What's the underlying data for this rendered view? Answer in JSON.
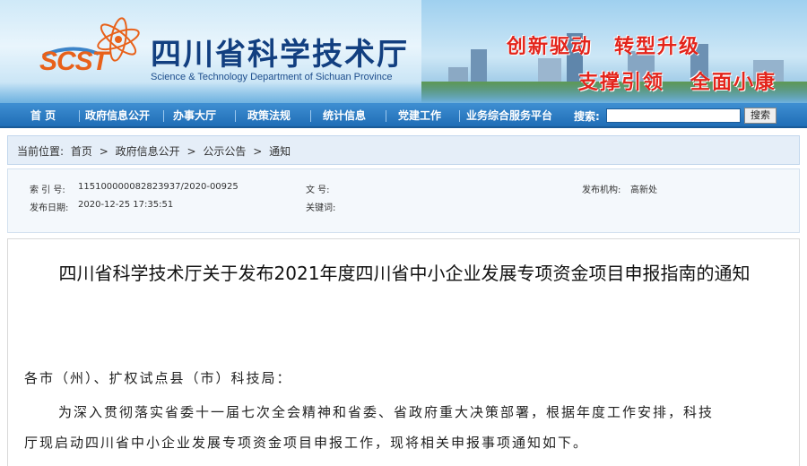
{
  "header": {
    "logo_text": "SCST",
    "site_title": "四川省科学技术厅",
    "site_subtitle": "Science & Technology Department of Sichuan Province",
    "slogans": [
      "创新驱动",
      "转型升级",
      "支撑引领",
      "全面小康"
    ],
    "colors": {
      "title": "#123f80",
      "slogan": "#e3241b",
      "logo": "#e8611a"
    }
  },
  "nav": {
    "items": [
      "首 页",
      "政府信息公开",
      "办事大厅",
      "政策法规",
      "统计信息",
      "党建工作",
      "业务综合服务平台"
    ],
    "search_label": "搜索:",
    "search_value": "",
    "search_button": "搜索"
  },
  "breadcrumb": {
    "label": "当前位置:",
    "items": [
      "首页",
      "政府信息公开",
      "公示公告",
      "通知"
    ],
    "separator": ">"
  },
  "meta": {
    "index_label": "索 引 号:",
    "index_value": "115100000082823937/2020-00925",
    "doc_label": "文 号:",
    "doc_value": "",
    "org_label": "发布机构:",
    "org_value": "高新处",
    "date_label": "发布日期:",
    "date_value": "2020-12-25 17:35:51",
    "keyword_label": "关键词:",
    "keyword_value": ""
  },
  "article": {
    "title": "四川省科学技术厅关于发布2021年度四川省中小企业发展专项资金项目申报指南的通知",
    "salutation": "各市（州）、扩权试点县（市）科技局：",
    "para1_line1": "为深入贯彻落实省委十一届七次全会精神和省委、省政府重大决策部署，根据年度工作安排，科技",
    "para1_line2": "厅现启动四川省中小企业发展专项资金项目申报工作，现将相关申报事项通知如下。"
  }
}
